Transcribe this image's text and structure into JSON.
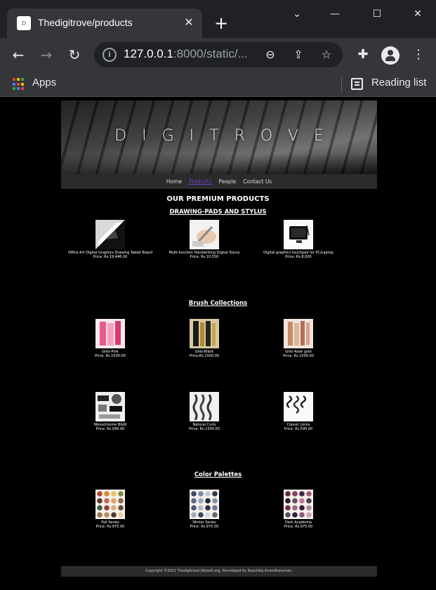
{
  "browser": {
    "tab_title": "Thedigitrove/products",
    "url_host": "127.0.0.1",
    "url_rest": ":8000/static/...",
    "apps_label": "Apps",
    "reading_list_label": "Reading list"
  },
  "site": {
    "banner_text": "DIGITROVE",
    "nav": [
      "Home",
      "Products",
      "People",
      "Contact Us"
    ],
    "active_nav": "Products",
    "page_heading": "OUR PREMIUM PRODUCTS",
    "footer": "Copyright ©2021 Thedigitrove.Ubtsoft.org, Developed by Kaushika Anandharaman."
  },
  "sections": [
    {
      "title": "DRAWING-PADS AND STYLUS",
      "products": [
        {
          "name": "Office Art Digital Graphics Drawing Tablet Board",
          "price": "Price: Rs.19,446.00",
          "icon": "drawing-tablet-icon"
        },
        {
          "name": "Multi-function Handwriting Digital Stylus",
          "price": "Price: Rs.10,550",
          "icon": "stylus-icon"
        },
        {
          "name": "Digital graphics touchpad for PC/Laptop",
          "price": "Price: Rs.8,000",
          "icon": "touchpad-icon"
        }
      ]
    },
    {
      "title": "Brush Collections",
      "products": [
        {
          "name": "Glits-Pink",
          "price": "Price: Rs.1500.00",
          "icon": "brush-pink-icon"
        },
        {
          "name": "Glits-Black",
          "price": "Price:Rs.1500.00",
          "icon": "brush-black-icon"
        },
        {
          "name": "Glits-Rose gold",
          "price": "Price: Rs.1500.00",
          "icon": "brush-rosegold-icon"
        },
        {
          "name": "Monochrome B&W",
          "price": "Price: Rs.999.00",
          "icon": "brush-monochrome-icon"
        },
        {
          "name": "Natural Curls",
          "price": "Price: Rs.2300.00",
          "icon": "brush-curls-icon"
        },
        {
          "name": "Classic Locks",
          "price": "Price: Rs.595.00",
          "icon": "brush-locks-icon"
        }
      ]
    },
    {
      "title": "Color Palettes",
      "products": [
        {
          "name": "Fall Series",
          "price": "Price: Rs.975.00",
          "icon": "palette-fall-icon"
        },
        {
          "name": "Winter Series",
          "price": "Price: Rs.975.00",
          "icon": "palette-winter-icon"
        },
        {
          "name": "Dark Academia",
          "price": "Price: Rs.975.00",
          "icon": "palette-dark-icon"
        }
      ]
    }
  ],
  "colors": {
    "active_nav": "#6a3fc8",
    "apps_grid": [
      "#ea4335",
      "#fbbc05",
      "#34a853",
      "#4285f4",
      "#ea4335",
      "#fbbc05",
      "#34a853",
      "#4285f4",
      "#ea4335"
    ]
  }
}
